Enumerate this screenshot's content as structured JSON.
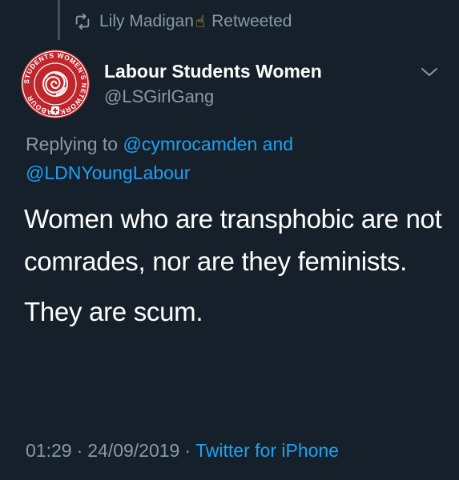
{
  "retweet": {
    "user": "Lily Madigan",
    "emoji": "☝",
    "status": "Retweeted"
  },
  "author": {
    "display_name": "Labour Students Women",
    "handle": "@LSGirlGang",
    "avatar_text": "STUDENTS WOMEN'S NETWORK LABOUR"
  },
  "reply": {
    "prefix": "Replying to",
    "mention_1": "@cymrocamden",
    "joiner": "and",
    "mention_2": "@LDNYoungLabour"
  },
  "tweet": {
    "paragraph_1": "Women who are transphobic are not comrades, nor are they feminists.",
    "paragraph_2": "They are scum."
  },
  "meta": {
    "time": "01:29",
    "separator": "·",
    "date": "24/09/2019",
    "source": "Twitter for iPhone"
  },
  "colors": {
    "background": "#15202b",
    "text": "#ffffff",
    "muted": "#8899a6",
    "link": "#1da1f2",
    "avatar_red": "#c0272d"
  },
  "icons": {
    "retweet": "retweet-icon",
    "hand": "pointing-up-hand-icon",
    "chevron": "chevron-down-icon",
    "avatar_rose": "rose-logo-icon"
  }
}
